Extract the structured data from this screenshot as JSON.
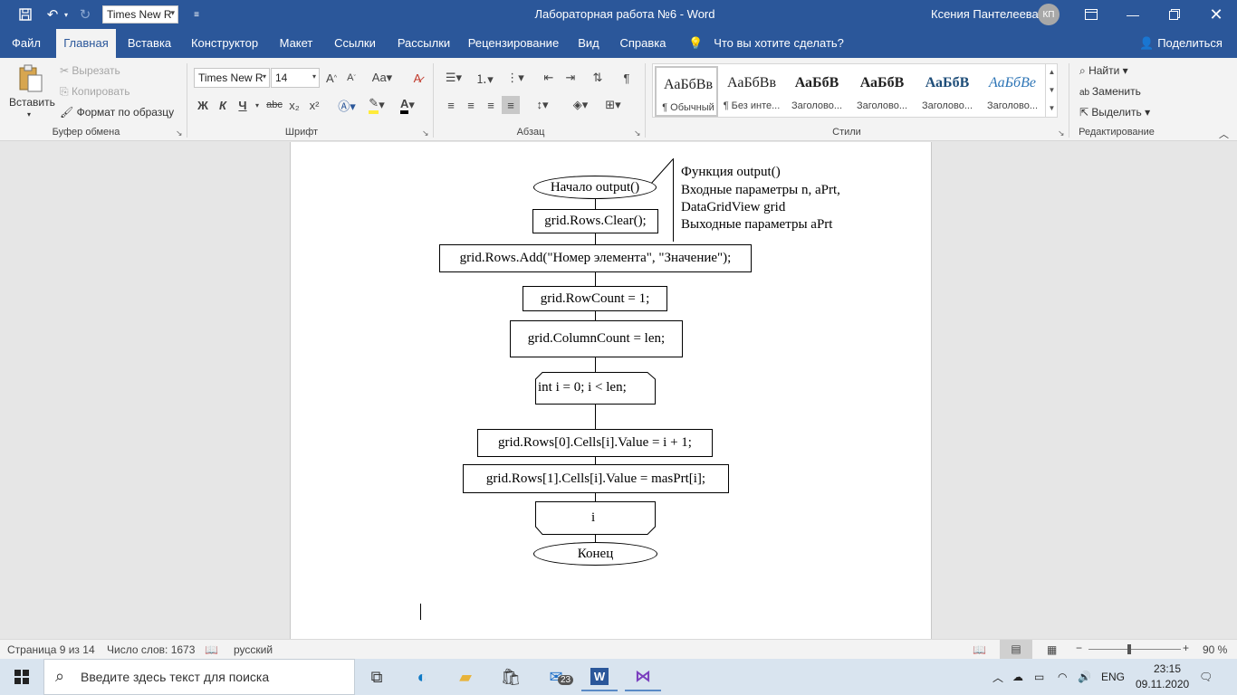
{
  "window": {
    "title": "Лабораторная работа №6  -  Word",
    "user": "Ксения Пантелеева",
    "user_initials": "КП",
    "quick_font": "Times New R"
  },
  "tabs": [
    {
      "label": "Файл"
    },
    {
      "label": "Главная"
    },
    {
      "label": "Вставка"
    },
    {
      "label": "Конструктор"
    },
    {
      "label": "Макет"
    },
    {
      "label": "Ссылки"
    },
    {
      "label": "Рассылки"
    },
    {
      "label": "Рецензирование"
    },
    {
      "label": "Вид"
    },
    {
      "label": "Справка"
    }
  ],
  "tell_me": "Что вы хотите сделать?",
  "share": "Поделиться",
  "ribbon": {
    "clipboard": {
      "label": "Буфер обмена",
      "paste": "Вставить",
      "cut": "Вырезать",
      "copy": "Копировать",
      "format_painter": "Формат по образцу"
    },
    "font": {
      "label": "Шрифт",
      "family": "Times New R",
      "size": "14",
      "bold": "Ж",
      "italic": "К",
      "underline": "Ч",
      "strike": "abc",
      "subscript": "x₂",
      "superscript": "x²"
    },
    "paragraph": {
      "label": "Абзац"
    },
    "styles": {
      "label": "Стили",
      "items": [
        {
          "sample": "АаБбВв",
          "name": "¶ Обычный"
        },
        {
          "sample": "АаБбВв",
          "name": "¶ Без инте..."
        },
        {
          "sample": "АаБбВ",
          "name": "Заголово..."
        },
        {
          "sample": "АаБбВ",
          "name": "Заголово..."
        },
        {
          "sample": "АаБбВ",
          "name": "Заголово..."
        },
        {
          "sample": "АаБбВе",
          "name": "Заголово..."
        }
      ]
    },
    "editing": {
      "label": "Редактирование",
      "find": "Найти",
      "replace": "Заменить",
      "select": "Выделить"
    }
  },
  "flowchart": {
    "comment": [
      "Функция output()",
      "Входные параметры n, aPrt,",
      "DataGridView grid",
      "Выходные параметры aPrt"
    ],
    "start": "Начало output()",
    "step1": "grid.Rows.Clear();",
    "step2": "grid.Rows.Add(\"Номер элемента\", \"Значение\");",
    "step3": "grid.RowCount = 1;",
    "step4": "grid.ColumnCount = len;",
    "loop_start": "int i = 0; i < len;",
    "step5": "grid.Rows[0].Cells[i].Value = i + 1;",
    "step6": "grid.Rows[1].Cells[i].Value = masPrt[i];",
    "loop_end": "i",
    "end": "Конец"
  },
  "status": {
    "page": "Страница 9 из 14",
    "words": "Число слов: 1673",
    "language": "русский",
    "zoom": "90 %",
    "zoom_value": 90
  },
  "taskbar": {
    "search_placeholder": "Введите здесь текст для поиска",
    "mail_badge": "23",
    "lang": "ENG",
    "time": "23:15",
    "date": "09.11.2020"
  }
}
